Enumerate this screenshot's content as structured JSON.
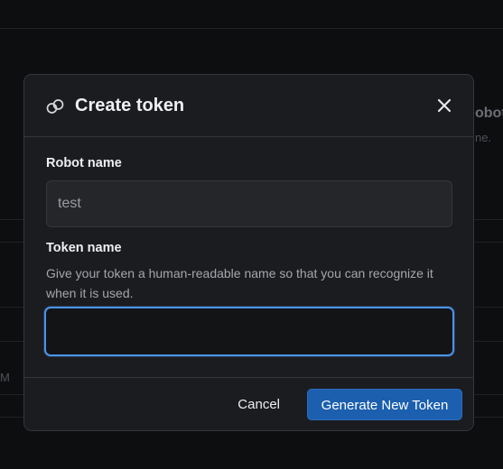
{
  "background": {
    "partial_heading": "obot",
    "partial_subtext": "ne.",
    "partial_left_text": "M"
  },
  "dialog": {
    "title": "Create token",
    "title_icon": "link-icon",
    "close_icon": "close-icon",
    "robot_name_label": "Robot name",
    "robot_name_value": "test",
    "token_name_label": "Token name",
    "token_name_help": "Give your token a human-readable name so that you can recognize it when it is used.",
    "token_name_value": "",
    "cancel_label": "Cancel",
    "submit_label": "Generate New Token"
  },
  "colors": {
    "accent": "#4b92e8",
    "primary_button": "#1b5fae",
    "dialog_bg": "#1b1c1f",
    "page_bg": "#0d0e10"
  }
}
